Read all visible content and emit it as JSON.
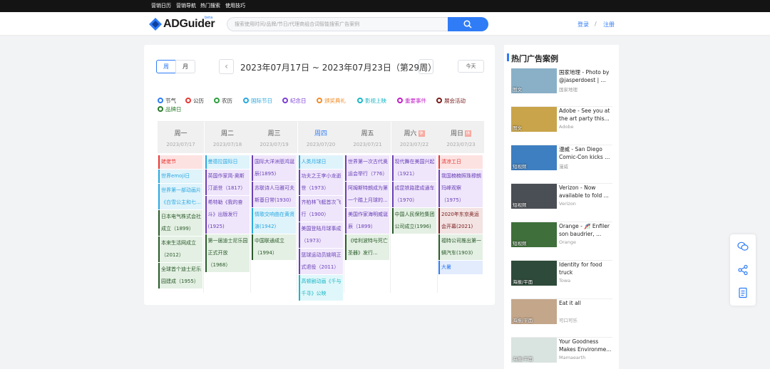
{
  "topnav": [
    "营销日历",
    "营销导航",
    "热门搜索",
    "使用技巧"
  ],
  "brand": {
    "name": "ADGuider",
    "beta": "beta"
  },
  "search": {
    "placeholder": "搜索使用时间/品牌/节日/代理商组合词智能搜索广告案例"
  },
  "auth": {
    "login": "登录",
    "sep": "/",
    "register": "注册"
  },
  "toolbar": {
    "week": "周",
    "month": "月",
    "prev": "‹",
    "next": "›",
    "range": "2023年07月17日 ~ 2023年07月23日（第29周）",
    "today": "今天"
  },
  "legend": [
    {
      "label": "节气",
      "color": "#2f7cf6"
    },
    {
      "label": "公历",
      "color": "#e53935"
    },
    {
      "label": "农历",
      "color": "#2e9e3f"
    },
    {
      "label": "国际节日",
      "color": "#29a8e0"
    },
    {
      "label": "纪念日",
      "color": "#7b3fd6"
    },
    {
      "label": "颁奖典礼",
      "color": "#f28c28"
    },
    {
      "label": "影视上映",
      "color": "#1bb7c7"
    },
    {
      "label": "重要事件",
      "color": "#c21fc9"
    },
    {
      "label": "展会活动",
      "color": "#7a1c1c"
    },
    {
      "label": "品牌日",
      "color": "#2a7a2a"
    }
  ],
  "days": [
    {
      "name": "周一",
      "date": "2023/07/17",
      "rest": "",
      "today": false
    },
    {
      "name": "周二",
      "date": "2023/07/18",
      "rest": "",
      "today": false
    },
    {
      "name": "周三",
      "date": "2023/07/19",
      "rest": "",
      "today": false
    },
    {
      "name": "周四",
      "date": "2023/07/20",
      "rest": "",
      "today": true
    },
    {
      "name": "周五",
      "date": "2023/07/21",
      "rest": "",
      "today": false
    },
    {
      "name": "周六",
      "date": "2023/07/22",
      "rest": "休",
      "today": false
    },
    {
      "name": "周日",
      "date": "2023/07/23",
      "rest": "休",
      "today": false
    }
  ],
  "events": [
    [
      {
        "text": "姥佬节",
        "bg": "#fde2e2",
        "fg": "#e53935"
      },
      {
        "text": "世界emoji日",
        "bg": "#dff3fb",
        "fg": "#29a8e0"
      },
      {
        "text": "世界第一部动画片《白雪公主和七...",
        "bg": "#dff3fb",
        "fg": "#29a8e0"
      },
      {
        "text": "日本电气株式会社成立（1899）",
        "bg": "#e4f0e4",
        "fg": "#2a5a2a"
      },
      {
        "text": "本来生活网成立（2012）",
        "bg": "#e4f0e4",
        "fg": "#2a5a2a"
      },
      {
        "text": "全球首个迪士尼乐园建成（1955）",
        "bg": "#e4f0e4",
        "fg": "#2a5a2a"
      }
    ],
    [
      {
        "text": "曼德拉国际日",
        "bg": "#dff3fb",
        "fg": "#29a8e0"
      },
      {
        "text": "英国作家简·奥斯汀逝世（1817）",
        "bg": "#efe6fb",
        "fg": "#6a3fb6"
      },
      {
        "text": "希特勒《我的奋斗》出版发行(1925)",
        "bg": "#efe6fb",
        "fg": "#6a3fb6"
      },
      {
        "text": "第一届迪士尼乐园正式开放（1968）",
        "bg": "#e4f0e4",
        "fg": "#2a5a2a"
      }
    ],
    [
      {
        "text": "国际大洋洲悲鸿诞辰(1895)",
        "bg": "#efe6fb",
        "fg": "#6a3fb6"
      },
      {
        "text": "苏联诗人马雅可夫斯基日常(1930)",
        "bg": "#efe6fb",
        "fg": "#6a3fb6"
      },
      {
        "text": "情歌交响曲在黄贤演(1942)",
        "bg": "#dff3fb",
        "fg": "#29a8e0"
      },
      {
        "text": "中国联通成立（1994）",
        "bg": "#e4f0e4",
        "fg": "#2a5a2a"
      }
    ],
    [
      {
        "text": "人类月球日",
        "bg": "#dff3fb",
        "fg": "#29a8e0"
      },
      {
        "text": "功夫之王李小龙逝世（1973）",
        "bg": "#efe6fb",
        "fg": "#6a3fb6"
      },
      {
        "text": "齐柏林飞艇首次飞行（1900）",
        "bg": "#efe6fb",
        "fg": "#6a3fb6"
      },
      {
        "text": "美国登陆月球事成（1973）",
        "bg": "#efe6fb",
        "fg": "#6a3fb6"
      },
      {
        "text": "篮球运动员姚明正式退役（2011）",
        "bg": "#efe6fb",
        "fg": "#6a3fb6"
      },
      {
        "text": "高顿剧动画《千与千寻》公映",
        "bg": "#dff7fa",
        "fg": "#1bb7c7"
      }
    ],
    [
      {
        "text": "世界第一次古代奥运会举行（776）",
        "bg": "#efe6fb",
        "fg": "#6a3fb6"
      },
      {
        "text": "阿姆斯特朗成为第一个踏上月球的...",
        "bg": "#efe6fb",
        "fg": "#6a3fb6"
      },
      {
        "text": "美国作家海明威诞辰（1899）",
        "bg": "#efe6fb",
        "fg": "#6a3fb6"
      },
      {
        "text": "《哈利波特与死亡圣器》发行...",
        "bg": "#e4f0e4",
        "fg": "#2a5a2a"
      }
    ],
    [
      {
        "text": "现代舞在美国兴起（1921）",
        "bg": "#efe6fb",
        "fg": "#6a3fb6"
      },
      {
        "text": "成昆铁路建成通车（1970）",
        "bg": "#efe6fb",
        "fg": "#6a3fb6"
      },
      {
        "text": "中国人民保险集团公司成立(1996)",
        "bg": "#e4f0e4",
        "fg": "#2a5a2a"
      }
    ],
    [
      {
        "text": "清凉工日",
        "bg": "#fde2e2",
        "fg": "#e53935"
      },
      {
        "text": "我国楠楠照珠穆朗玛峰观察（1975）",
        "bg": "#efe6fb",
        "fg": "#6a3fb6"
      },
      {
        "text": "2020年东京奥运会开幕(2021)",
        "bg": "#f3e3e3",
        "fg": "#7a1c1c"
      },
      {
        "text": "福特公司推出第一辆汽车(1903)",
        "bg": "#e4f0e4",
        "fg": "#2a5a2a"
      },
      {
        "text": "大暑",
        "bg": "#e2ecfd",
        "fg": "#2f7cf6"
      }
    ]
  ],
  "cases_title": "热门广告案例",
  "cases": [
    {
      "title": "国家地理 - Photo by @jasperdoest | ...",
      "brand": "国家地理",
      "tag": "图文",
      "thumb": "#8ab0c8"
    },
    {
      "title": "Adobe - See you at the art party this...",
      "brand": "Adobe",
      "tag": "图文",
      "thumb": "#c9a44a"
    },
    {
      "title": "漫威 - San Diego Comic-Con kicks ...",
      "brand": "漫威",
      "tag": "短视频",
      "thumb": "#3d7fc1"
    },
    {
      "title": "Verizon - Now available to fold ...",
      "brand": "Verizon",
      "tag": "短视频",
      "thumb": "#4a4f55"
    },
    {
      "title": "Orange - 🎢 Enfiler son baudrier, ...",
      "brand": "Orange",
      "tag": "短视频",
      "thumb": "#3f6f3a"
    },
    {
      "title": "Identity for food truck",
      "brand": "Towa",
      "tag": "海报/平面",
      "thumb": "#2e4a3a"
    },
    {
      "title": "Eat it all",
      "brand": "可口可乐",
      "tag": "海报/平面",
      "thumb": "#c4a68a"
    },
    {
      "title": "Your Goodness Makes Environme...",
      "brand": "Mamaearth",
      "tag": "海报/平面",
      "thumb": "#d9e3df"
    }
  ],
  "float_icons": [
    "wechat-icon",
    "share-icon",
    "document-icon"
  ]
}
